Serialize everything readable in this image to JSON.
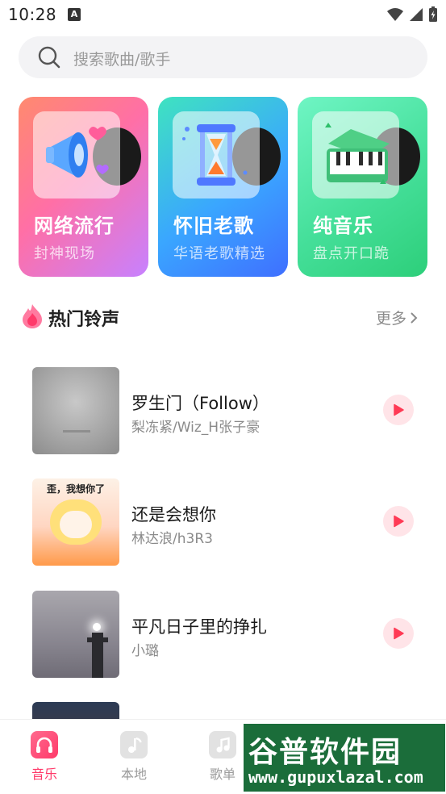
{
  "status_bar": {
    "time": "10:28",
    "indicator": "A"
  },
  "search": {
    "placeholder": "搜索歌曲/歌手"
  },
  "categories": [
    {
      "title": "网络流行",
      "subtitle": "封神现场",
      "icon": "megaphone-icon"
    },
    {
      "title": "怀旧老歌",
      "subtitle": "华语老歌精选",
      "icon": "hourglass-icon"
    },
    {
      "title": "纯音乐",
      "subtitle": "盘点开口跪",
      "icon": "piano-icon"
    }
  ],
  "section": {
    "title": "热门铃声",
    "more": "更多"
  },
  "songs": [
    {
      "title": "罗生门（Follow）",
      "artist": "梨冻紧/Wiz_H张子豪"
    },
    {
      "title": "还是会想你",
      "artist": "林达浪/h3R3",
      "cover_text": "歪，我想你了"
    },
    {
      "title": "平凡日子里的挣扎",
      "artist": "小璐"
    },
    {
      "title": "",
      "artist": ""
    }
  ],
  "bottom_nav": [
    {
      "label": "音乐",
      "active": true
    },
    {
      "label": "本地",
      "active": false
    },
    {
      "label": "歌单",
      "active": false
    }
  ],
  "watermark": {
    "line1": "谷普软件园",
    "line2": "www.gupuxlazal.com"
  },
  "colors": {
    "accent": "#ff3a6a",
    "play_bg": "#ffe4e8"
  }
}
